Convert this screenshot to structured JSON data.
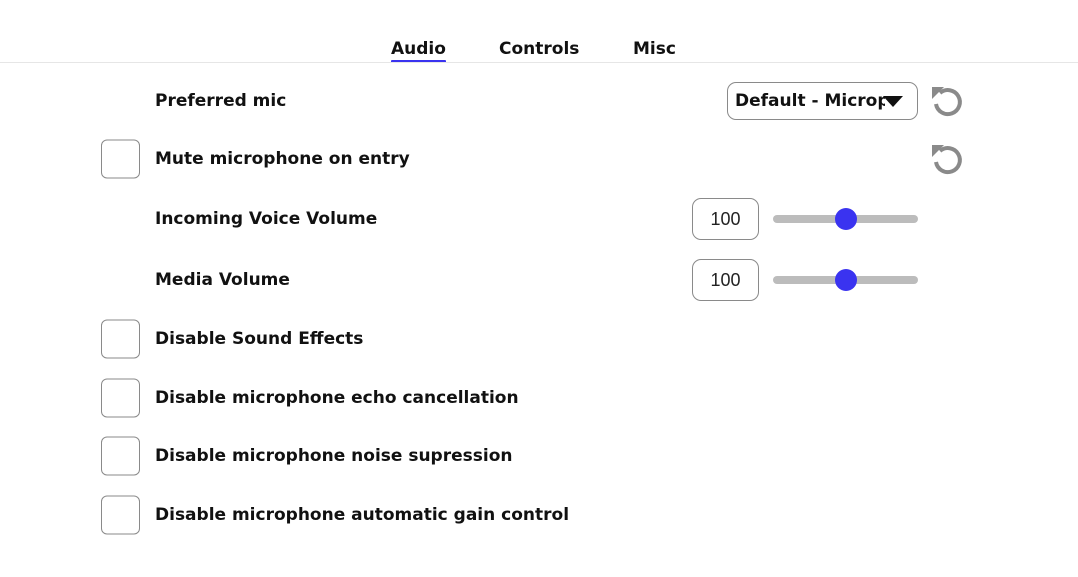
{
  "tabs": [
    {
      "label": "Audio",
      "active": true
    },
    {
      "label": "Controls",
      "active": false
    },
    {
      "label": "Misc",
      "active": false
    }
  ],
  "settings": {
    "preferred_mic": {
      "label": "Preferred mic",
      "value": "Default - Microphone"
    },
    "mute_on_entry": {
      "label": "Mute microphone on entry",
      "checked": false
    },
    "incoming_voice_volume": {
      "label": "Incoming Voice Volume",
      "value": "100",
      "slider_fraction": 0.5
    },
    "media_volume": {
      "label": "Media Volume",
      "value": "100",
      "slider_fraction": 0.5
    },
    "disable_sound_effects": {
      "label": "Disable Sound Effects",
      "checked": false
    },
    "disable_echo_cancellation": {
      "label": "Disable microphone echo cancellation",
      "checked": false
    },
    "disable_noise_suppression": {
      "label": "Disable microphone noise supression",
      "checked": false
    },
    "disable_auto_gain": {
      "label": "Disable microphone automatic gain control",
      "checked": false
    }
  },
  "icons": {
    "reset": "reset-icon",
    "dropdown": "triangle-down-icon"
  },
  "colors": {
    "accent": "#3a33f0",
    "icon_gray": "#8a8a8a",
    "track": "#bcbcbc"
  }
}
